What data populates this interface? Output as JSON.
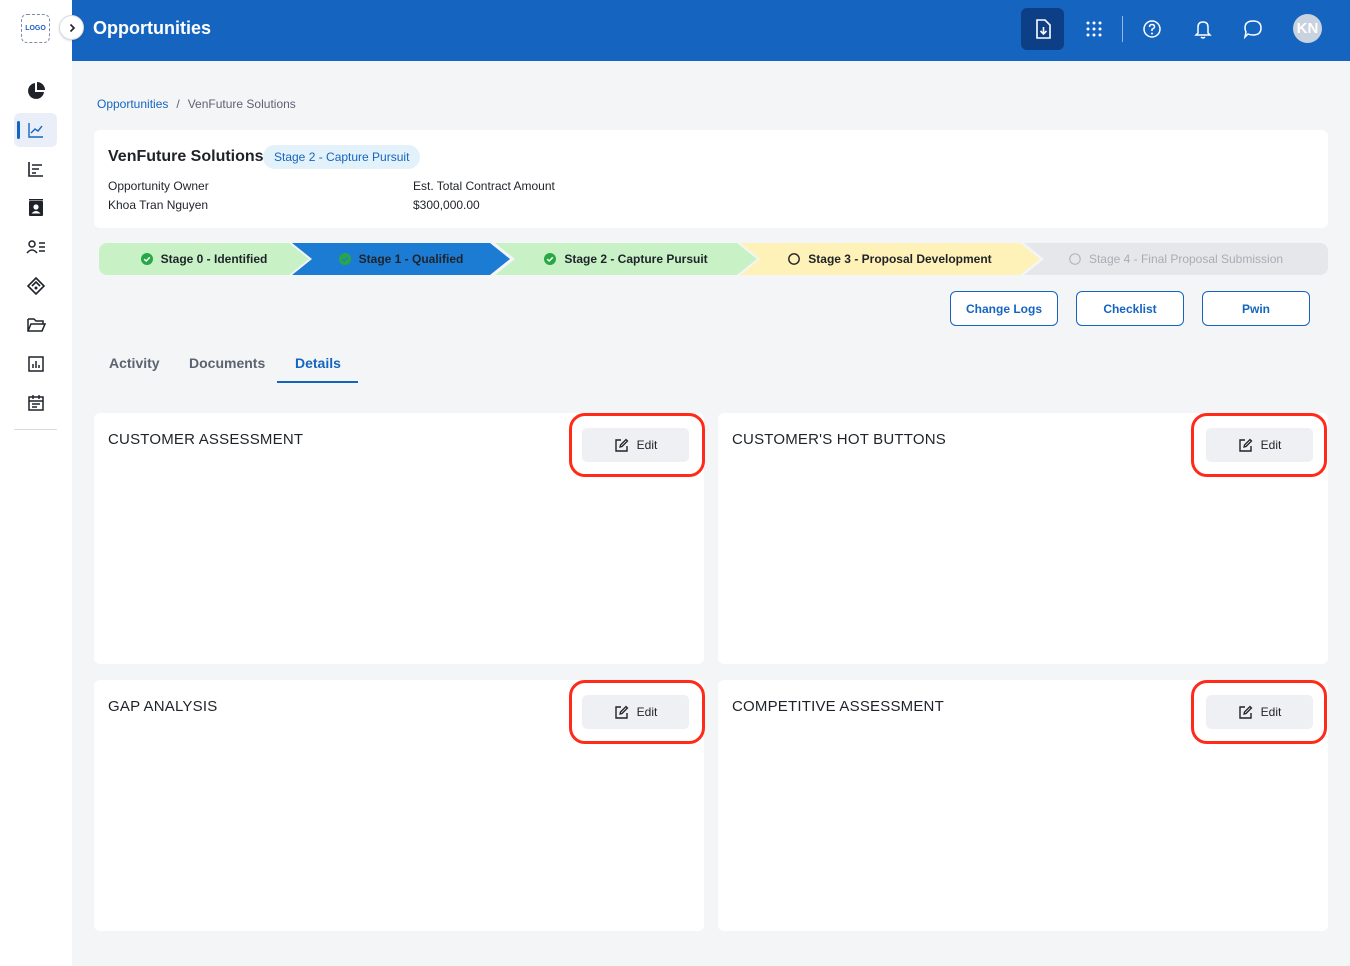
{
  "sidebar": {
    "logo_text": "LOGO",
    "items": [
      {
        "icon": "pie-chart-icon"
      },
      {
        "icon": "trend-chart-icon",
        "active": true
      },
      {
        "icon": "funnel-chart-icon"
      },
      {
        "icon": "contact-card-icon"
      },
      {
        "icon": "user-list-icon"
      },
      {
        "icon": "handshake-icon"
      },
      {
        "icon": "folder-open-icon"
      },
      {
        "icon": "bar-report-icon"
      },
      {
        "icon": "calendar-icon"
      }
    ]
  },
  "header": {
    "title": "Opportunities",
    "avatar_initials": "KN",
    "icons": [
      "download-doc-icon",
      "apps-grid-icon",
      "help-icon",
      "bell-icon",
      "chat-icon"
    ]
  },
  "breadcrumb": {
    "root": "Opportunities",
    "separator": "/",
    "current": "VenFuture Solutions"
  },
  "opportunity": {
    "name": "VenFuture Solutions",
    "stage_badge": "Stage 2 - Capture Pursuit",
    "owner_label": "Opportunity Owner",
    "owner_value": "Khoa Tran Nguyen",
    "amount_label": "Est. Total Contract Amount",
    "amount_value": "$300,000.00"
  },
  "stages": [
    {
      "label": "Stage 0 - Identified",
      "status": "done"
    },
    {
      "label": "Stage 1 - Qualified",
      "status": "done-current"
    },
    {
      "label": "Stage 2 - Capture Pursuit",
      "status": "done"
    },
    {
      "label": "Stage 3 - Proposal Development",
      "status": "in-progress"
    },
    {
      "label": "Stage 4 - Final Proposal Submission",
      "status": "pending"
    }
  ],
  "actions": {
    "change_logs": "Change Logs",
    "checklist": "Checklist",
    "pwin": "Pwin"
  },
  "tabs": [
    {
      "label": "Activity"
    },
    {
      "label": "Documents"
    },
    {
      "label": "Details",
      "active": true
    }
  ],
  "sections": [
    {
      "title": "CUSTOMER ASSESSMENT",
      "edit_label": "Edit"
    },
    {
      "title": "CUSTOMER'S HOT BUTTONS",
      "edit_label": "Edit"
    },
    {
      "title": "GAP ANALYSIS",
      "edit_label": "Edit"
    },
    {
      "title": "COMPETITIVE ASSESSMENT",
      "edit_label": "Edit"
    }
  ],
  "colors": {
    "primary": "#1565c0",
    "header_active": "#0d3f86",
    "stage_done": "#c8f2c6",
    "stage_current": "#1c7cd4",
    "stage_in_progress": "#fff2b8",
    "stage_pending": "#e6e7ea",
    "check_green": "#27a844",
    "highlight": "#ff2a1a"
  }
}
